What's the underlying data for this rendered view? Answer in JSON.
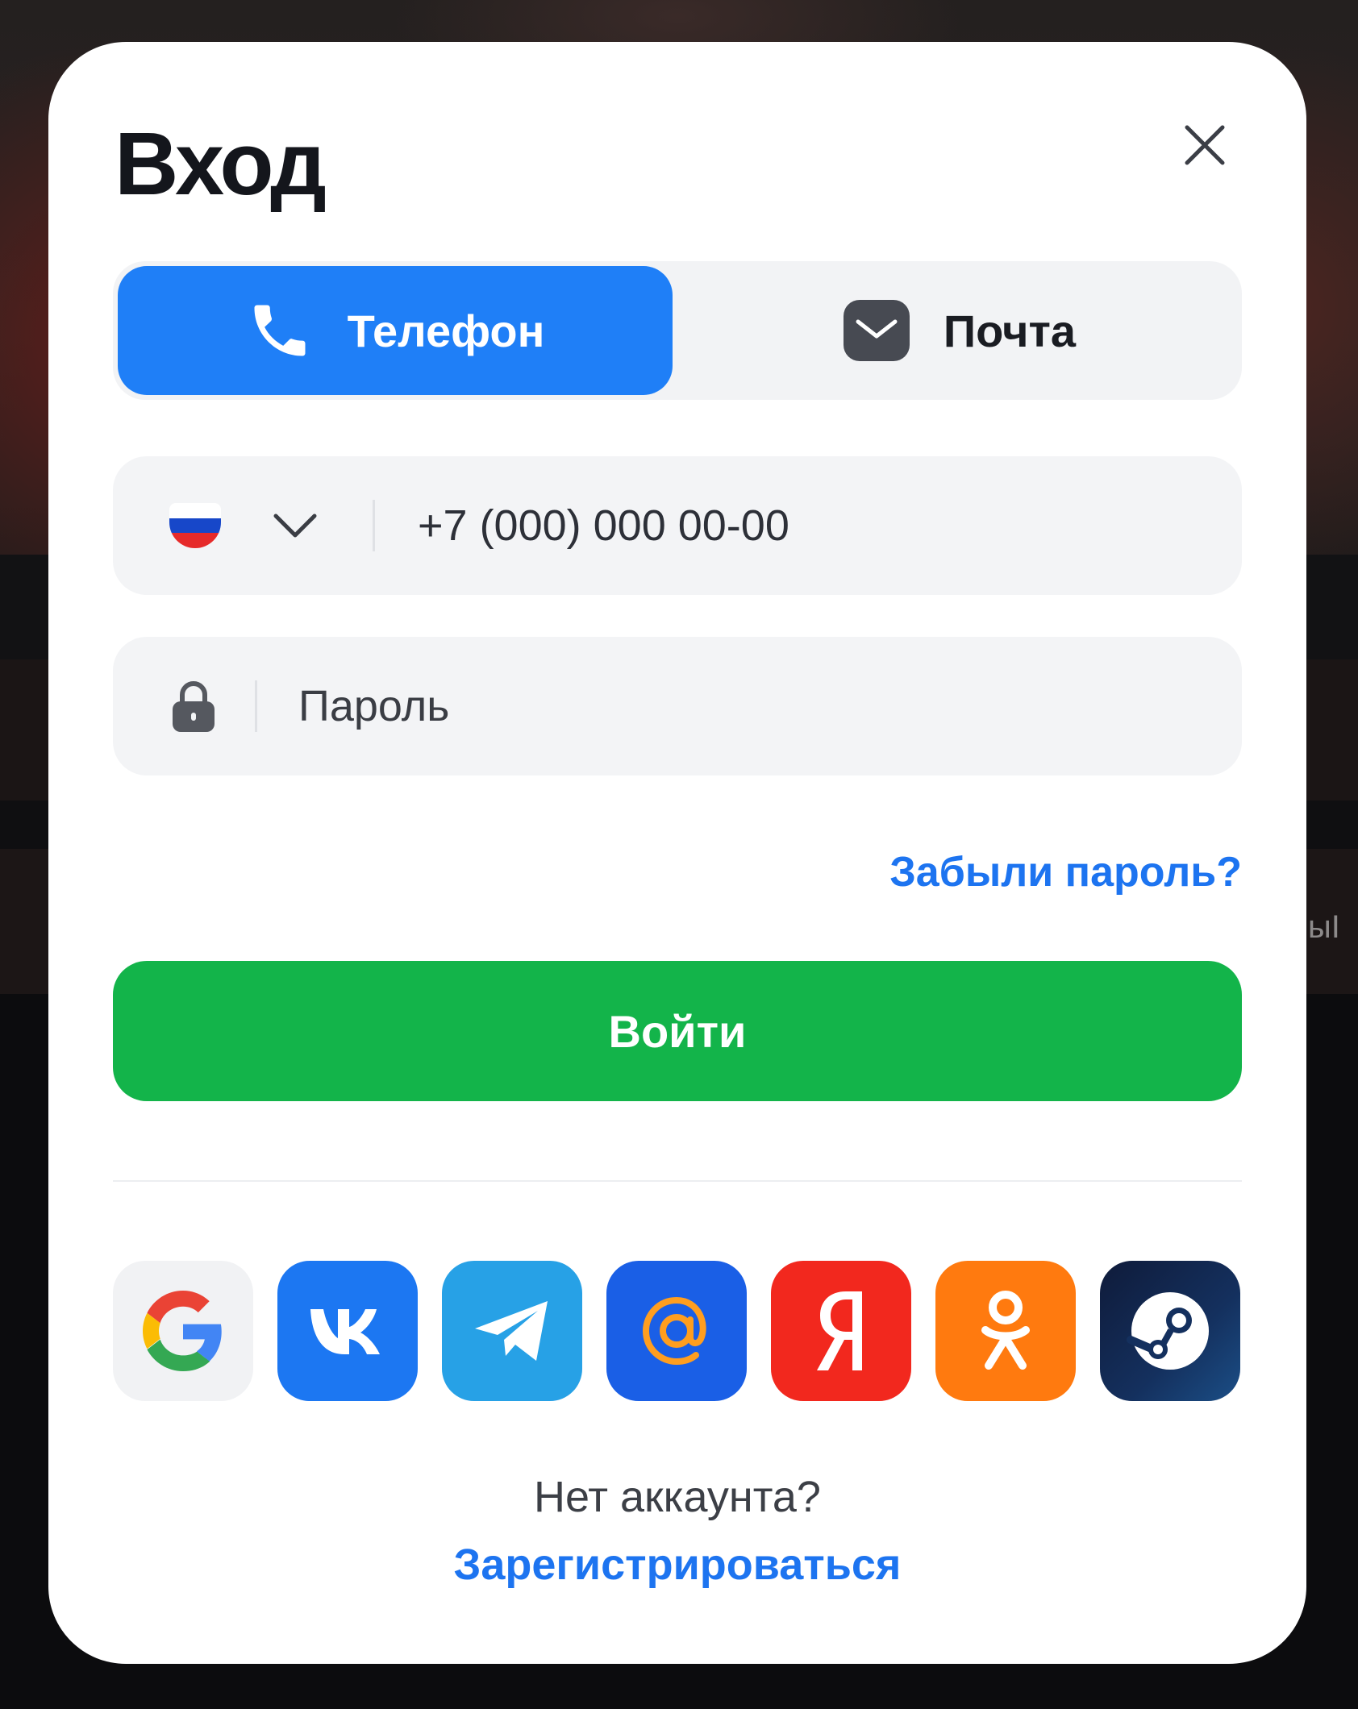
{
  "background": {
    "peek_text": "ыI"
  },
  "modal": {
    "title": "Вход",
    "tabs": [
      {
        "label": "Телефон",
        "active": true,
        "icon": "phone-icon"
      },
      {
        "label": "Почта",
        "active": false,
        "icon": "mail-icon"
      }
    ],
    "phone": {
      "placeholder": "+7 (000) 000 00-00",
      "country_flag": "russia-flag",
      "flag_colors": [
        "#ffffff",
        "#1747c9",
        "#e62a2a"
      ]
    },
    "password": {
      "placeholder": "Пароль"
    },
    "forgot_label": "Забыли пароль?",
    "login_label": "Войти",
    "social": [
      {
        "name": "google",
        "icon": "google-icon"
      },
      {
        "name": "vk",
        "icon": "vk-icon"
      },
      {
        "name": "telegram",
        "icon": "telegram-icon"
      },
      {
        "name": "mail-ru",
        "icon": "mail-ru-icon"
      },
      {
        "name": "yandex",
        "icon": "yandex-icon"
      },
      {
        "name": "odnoklassniki",
        "icon": "odnoklassniki-icon"
      },
      {
        "name": "steam",
        "icon": "steam-icon"
      }
    ],
    "no_account_text": "Нет аккаунта?",
    "register_label": "Зарегистрироваться"
  },
  "colors": {
    "accent_blue": "#1f7ff7",
    "link_blue": "#1d74f0",
    "login_green": "#13b44a"
  }
}
